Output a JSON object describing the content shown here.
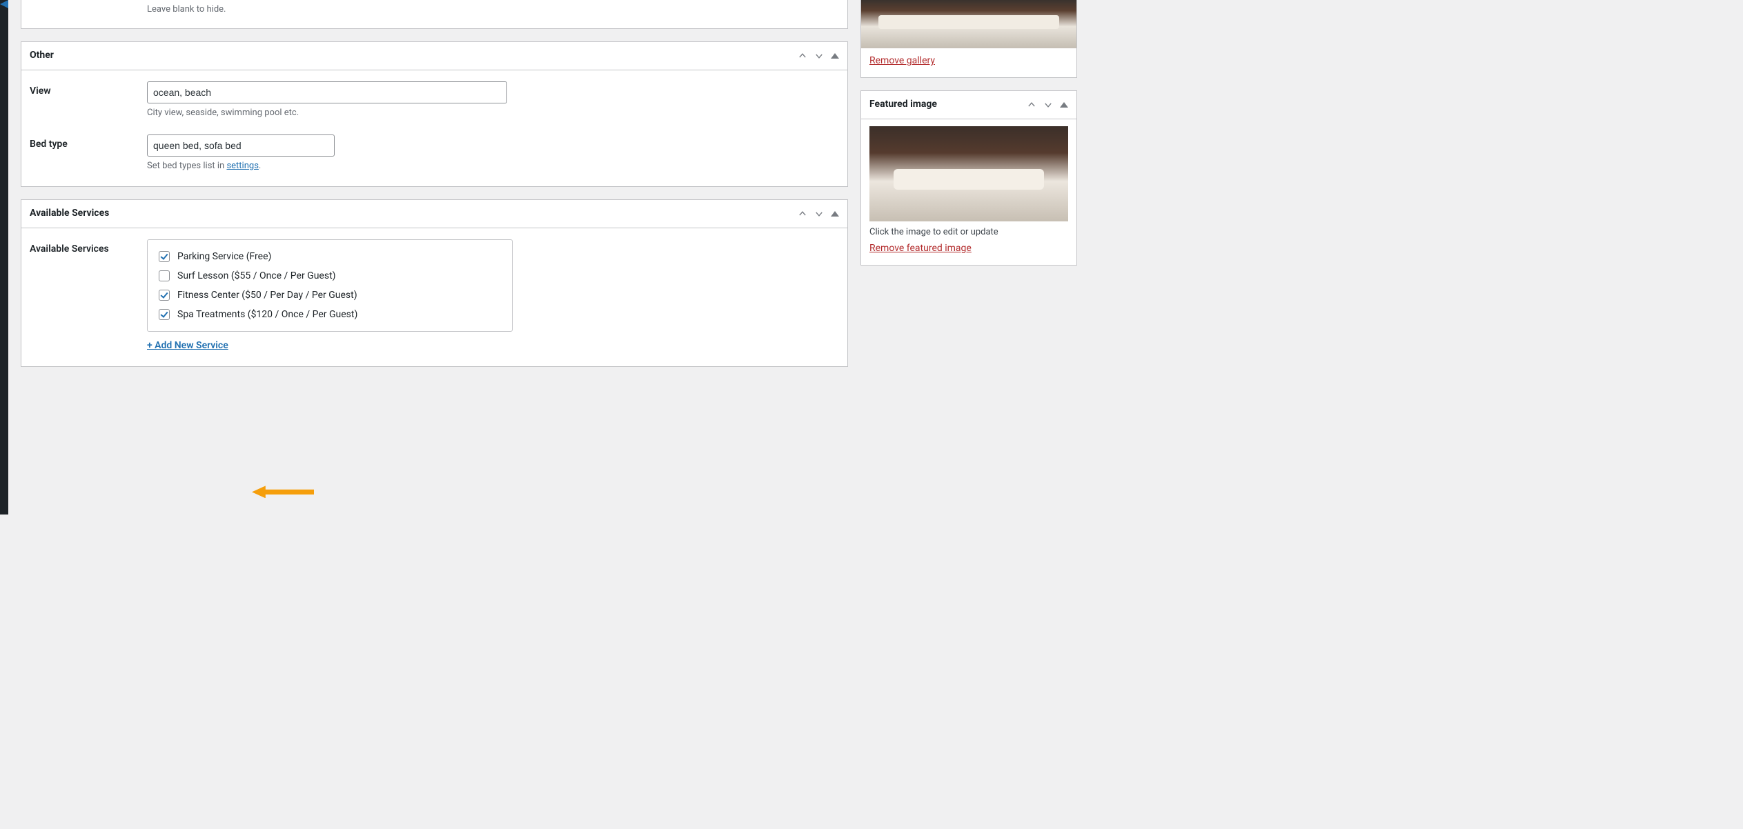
{
  "top_panel": {
    "help": "Leave blank to hide."
  },
  "other_panel": {
    "title": "Other",
    "view_label": "View",
    "view_value": "ocean, beach",
    "view_help": "City view, seaside, swimming pool etc.",
    "bed_label": "Bed type",
    "bed_value": "queen bed, sofa bed",
    "bed_help_pre": "Set bed types list in ",
    "bed_help_link": "settings",
    "bed_help_post": "."
  },
  "services_panel": {
    "title": "Available Services",
    "label": "Available Services",
    "items": [
      {
        "label": "Parking Service (Free)",
        "checked": true
      },
      {
        "label": "Surf Lesson ($55 / Once / Per Guest)",
        "checked": false
      },
      {
        "label": "Fitness Center ($50 / Per Day / Per Guest)",
        "checked": true
      },
      {
        "label": "Spa Treatments ($120 / Once / Per Guest)",
        "checked": true
      }
    ],
    "add_new": "+ Add New Service"
  },
  "gallery_panel": {
    "remove_link": "Remove gallery"
  },
  "featured_panel": {
    "title": "Featured image",
    "caption": "Click the image to edit or update",
    "remove_link": "Remove featured image"
  }
}
